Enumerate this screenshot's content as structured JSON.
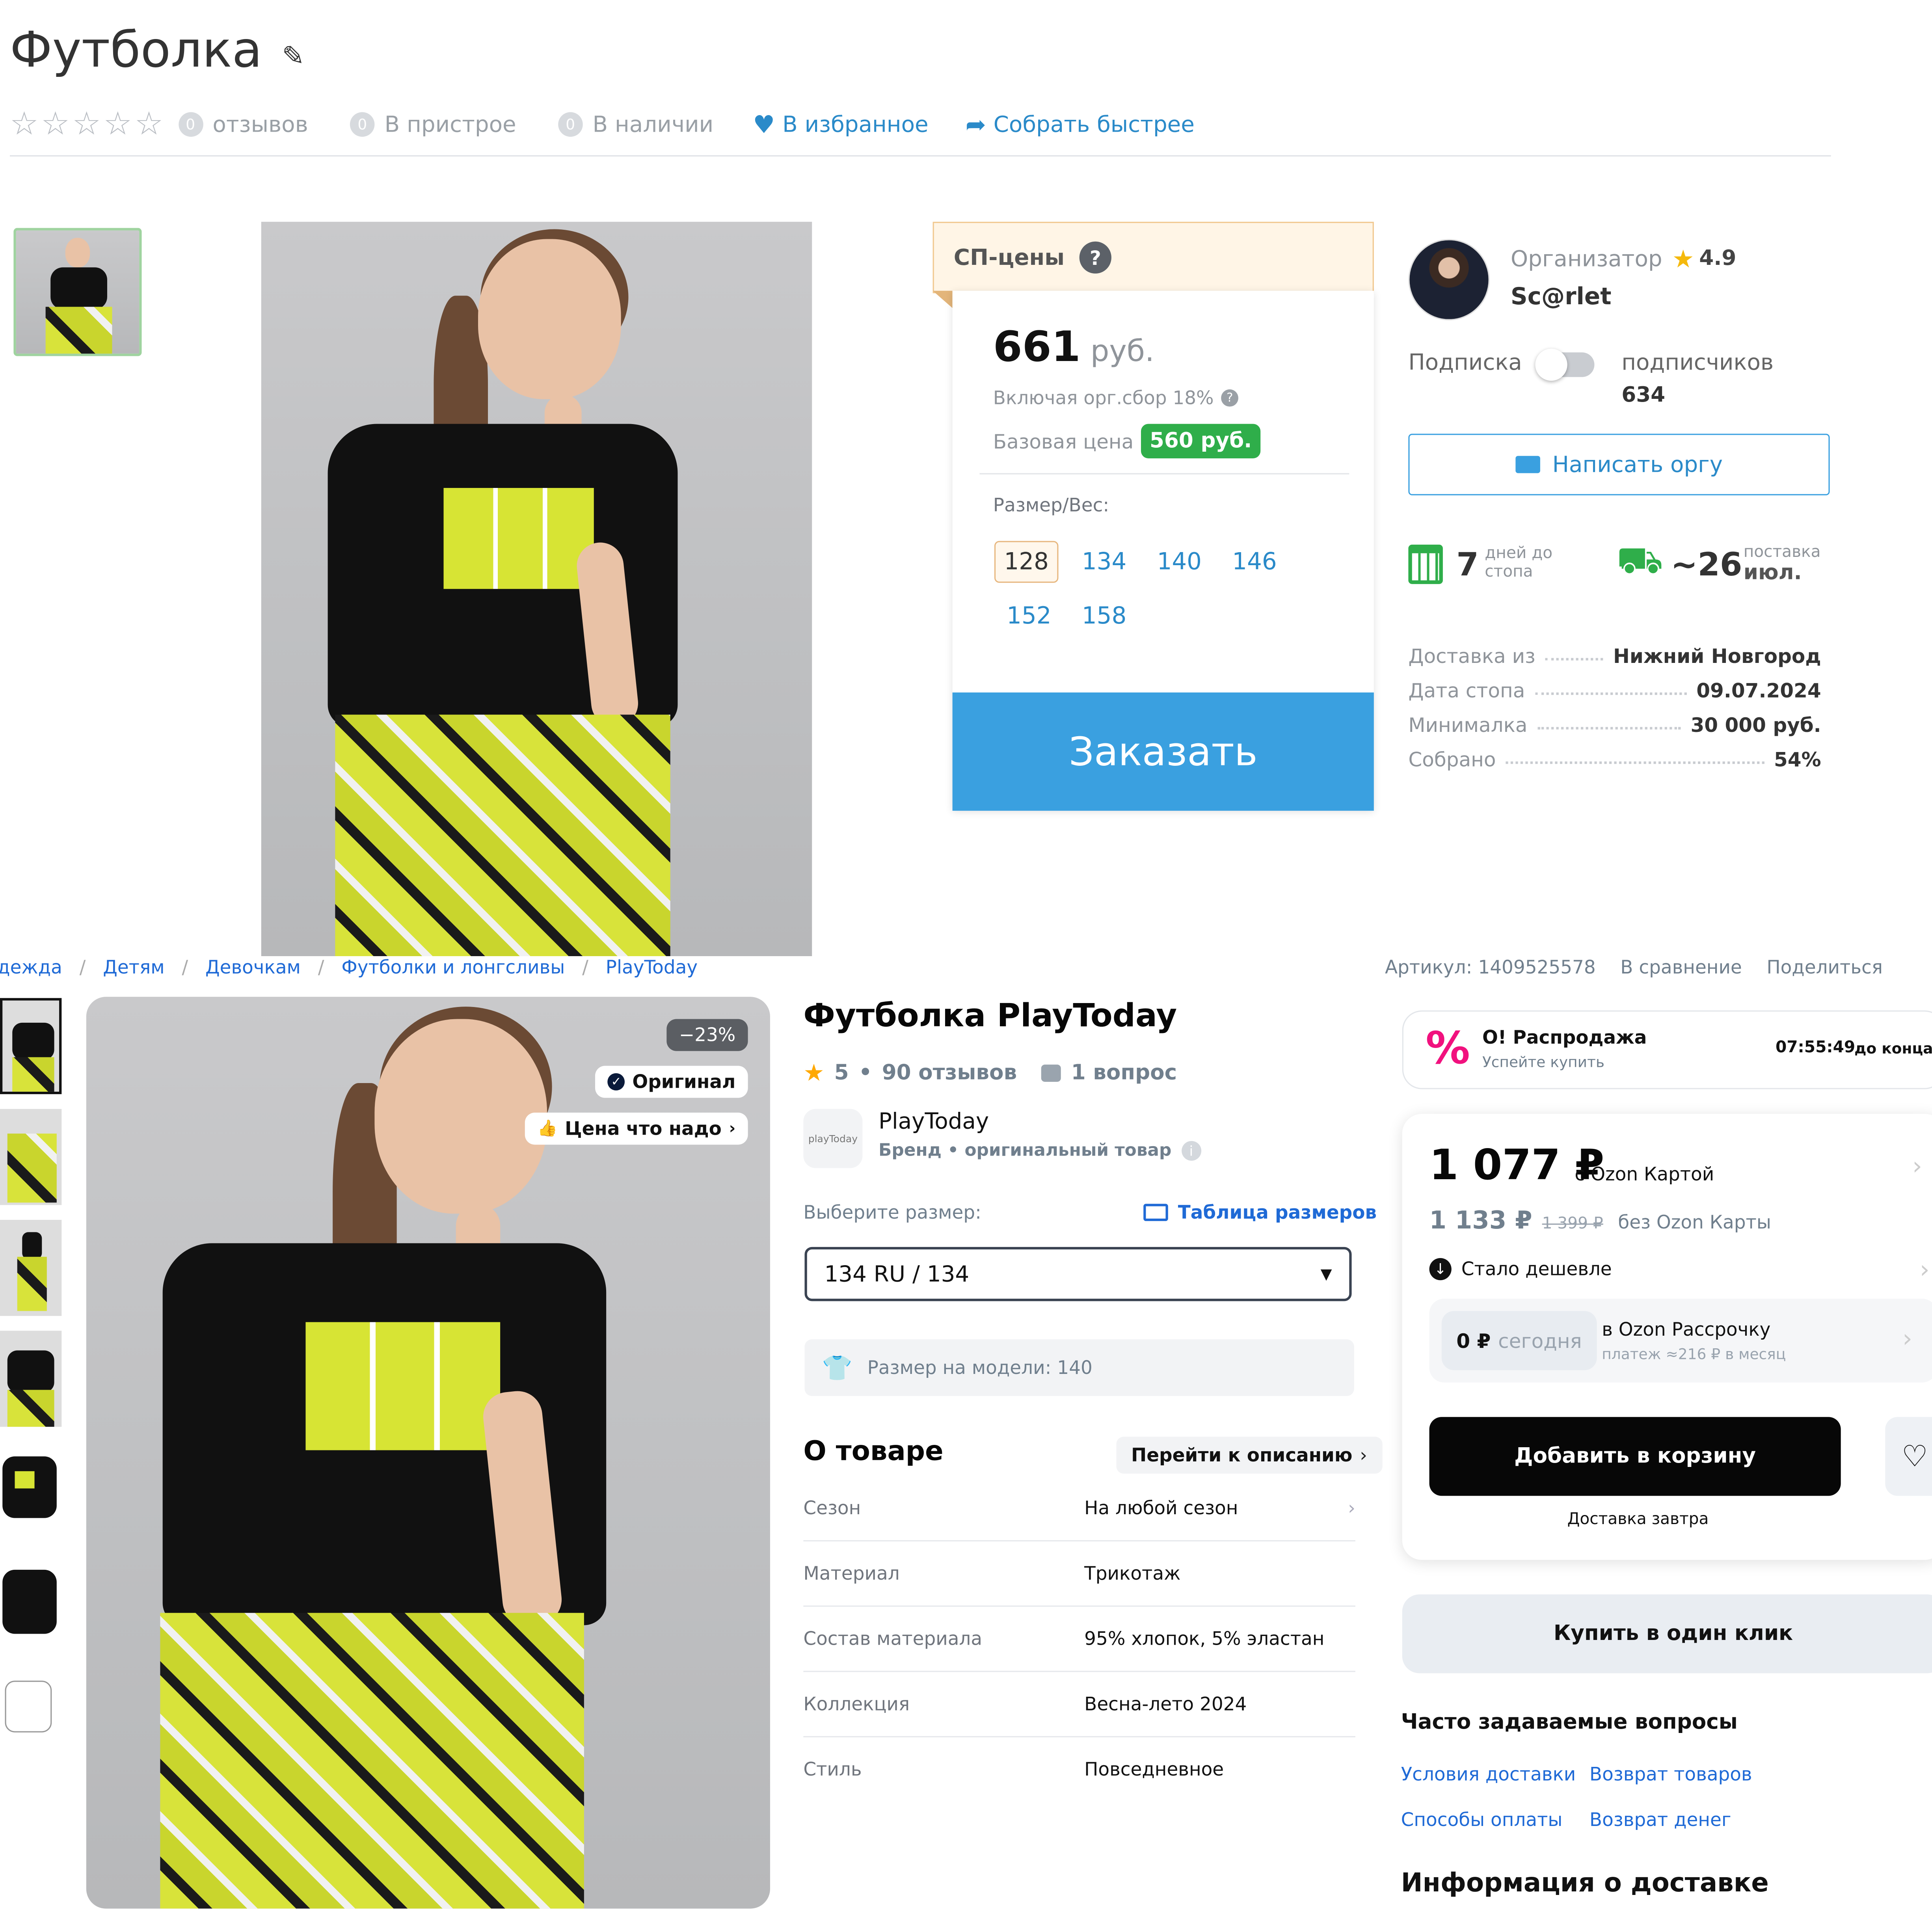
{
  "top": {
    "title": "Футболка",
    "reviews_count": "0",
    "reviews_label": "отзывов",
    "attach_count": "0",
    "attach_label": "В пристрое",
    "stock_count": "0",
    "stock_label": "В наличии",
    "fav_label": "В избранное",
    "fast_label": "Собрать быстрее",
    "sp_prices_label": "СП-цены",
    "price_value": "661",
    "price_unit": "руб.",
    "including_fee": "Включая орг.сбор 18%",
    "base_price_label": "Базовая цена",
    "base_price_value": "560 руб.",
    "size_label": "Размер/Вес:",
    "sizes": [
      "128",
      "134",
      "140",
      "146",
      "152",
      "158"
    ],
    "selected_size": "128",
    "order_button": "Заказать",
    "organizer_label": "Организатор",
    "organizer_rating": "4.9",
    "organizer_name": "Sc@rlet",
    "subscription_label": "Подписка",
    "subscribers_label": "подписчиков",
    "subscribers_count": "634",
    "write_button": "Написать оргу",
    "days_value": "7",
    "days_label_1": "дней до",
    "days_label_2": "стопа",
    "delivery_value": "~26",
    "delivery_label_1": "поставка",
    "delivery_label_2": "июл.",
    "details": [
      {
        "k": "Доставка из",
        "v": "Нижний Новгород"
      },
      {
        "k": "Дата стопа",
        "v": "09.07.2024"
      },
      {
        "k": "Минималка",
        "v": "30 000 руб."
      },
      {
        "k": "Собрано",
        "v": "54%"
      }
    ],
    "accent": "#3aa0e0",
    "green": "#2fae4a"
  },
  "ozon": {
    "breadcrumbs": [
      "Одежда",
      "Детям",
      "Девочкам",
      "Футболки и лонгсливы",
      "PlayToday"
    ],
    "article": "Артикул: 1409525578",
    "compare": "В сравнение",
    "share": "Поделиться",
    "discount_badge": "−23%",
    "original_badge": "Оригинал",
    "price_badge": "Цена что надо",
    "product_title": "Футболка PlayToday",
    "rating": "5",
    "reviews": "90 отзывов",
    "questions": "1 вопрос",
    "brand_name": "PlayToday",
    "brand_logo_text": "playToday",
    "brand_sub": "Бренд • оригинальный товар",
    "choose_size": "Выберите размер:",
    "size_table": "Таблица размеров",
    "selected_size": "134 RU / 134",
    "model_size": "Размер на модели: 140",
    "about_title": "О товаре",
    "goto_desc": "Перейти к описанию",
    "attributes": [
      {
        "k": "Сезон",
        "v": "На любой сезон"
      },
      {
        "k": "Материал",
        "v": "Трикотаж"
      },
      {
        "k": "Состав материала",
        "v": "95% хлопок, 5% эластан"
      },
      {
        "k": "Коллекция",
        "v": "Весна-лето 2024"
      },
      {
        "k": "Стиль",
        "v": "Повседневное"
      }
    ],
    "sale_title": "О! Распродажа",
    "sale_sub": "Успейте купить",
    "sale_timer": "07:55:49",
    "sale_timer_suffix": "до конца",
    "card_price": "1 077 ₽",
    "card_price_label": "с Ozon Картой",
    "regular_price": "1 133 ₽",
    "old_price": "1 399 ₽",
    "no_card_label": "без Ozon Карты",
    "cheaper": "Стало дешевле",
    "installment_today": "0 ₽",
    "installment_today_label": "сегодня",
    "installment_title": "в Ozon Рассрочку",
    "installment_sub": "платеж ≈216 ₽ в месяц",
    "add_to_cart": "Добавить в корзину",
    "delivery_tomorrow": "Доставка завтра",
    "one_click": "Купить в один клик",
    "faq_title": "Часто задаваемые вопросы",
    "faq_links": [
      "Условия доставки",
      "Возврат товаров",
      "Способы оплаты",
      "Возврат денег"
    ],
    "delivery_info_title": "Информация о доставке"
  },
  "icons": [
    "star-icon",
    "heart-icon",
    "share-icon",
    "question-icon",
    "mail-icon",
    "calendar-icon",
    "delivery-hand-icon",
    "pencil-icon",
    "check-badge-icon",
    "thumb-up-icon",
    "chat-icon",
    "ruler-icon",
    "shirt-icon",
    "sale-percent-icon",
    "chevron-right-icon",
    "chevron-down-icon",
    "arrow-down-icon"
  ]
}
